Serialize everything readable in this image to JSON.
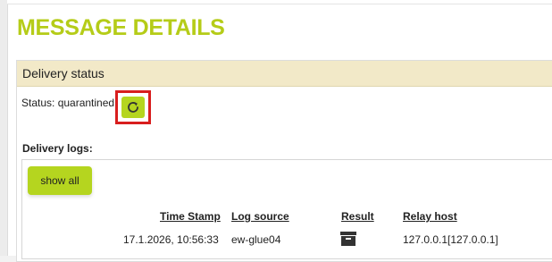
{
  "page": {
    "title": "MESSAGE DETAILS"
  },
  "delivery": {
    "header": "Delivery status",
    "status_label": "Status: quarantined",
    "refresh_icon": "refresh-icon",
    "logs_label": "Delivery logs:",
    "show_all_label": "show all",
    "columns": [
      "Time Stamp",
      "Log source",
      "Result",
      "Relay host"
    ],
    "rows": [
      {
        "timestamp": "17.1.2026, 10:56:33",
        "source": "ew-glue04",
        "result_icon": "archive-icon",
        "relay": "127.0.0.1[127.0.0.1]"
      }
    ]
  },
  "colors": {
    "accent": "#b5d51f",
    "title": "#b5cc18",
    "panel_header": "#f2e9c8",
    "highlight": "#d81e1e"
  }
}
